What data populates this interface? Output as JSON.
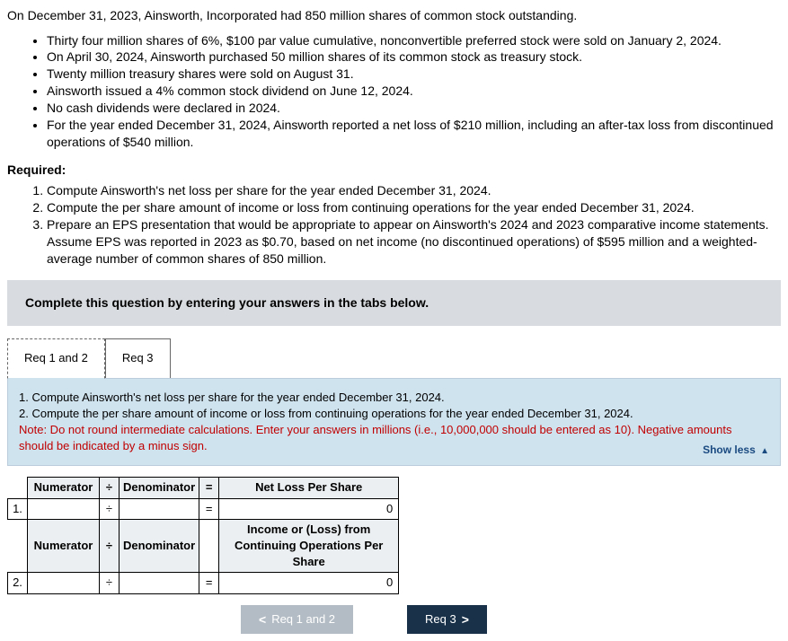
{
  "intro": "On December 31, 2023, Ainsworth, Incorporated had 850 million shares of common stock outstanding.",
  "bullets": [
    "Thirty four million shares of 6%, $100 par value cumulative, nonconvertible preferred stock were sold on January 2, 2024.",
    "On April 30, 2024, Ainsworth purchased 50 million shares of its common stock as treasury stock.",
    "Twenty million treasury shares were sold on August 31.",
    "Ainsworth issued a 4% common stock dividend on June 12, 2024.",
    "No cash dividends were declared in 2024.",
    "For the year ended December 31, 2024, Ainsworth reported a net loss of $210 million, including an after-tax loss from discontinued operations of $540 million."
  ],
  "required_label": "Required:",
  "requirements": [
    "Compute Ainsworth's net loss per share for the year ended December 31, 2024.",
    "Compute the per share amount of income or loss from continuing operations for the year ended December 31, 2024.",
    "Prepare an EPS presentation that would be appropriate to appear on Ainsworth's 2024 and 2023 comparative income statements. Assume EPS was reported in 2023 as $0.70, based on net income (no discontinued operations) of $595 million and a weighted-average number of common shares of 850 million."
  ],
  "instruction_box": "Complete this question by entering your answers in the tabs below.",
  "tabs": {
    "tab1": "Req 1 and 2",
    "tab2": "Req 3"
  },
  "tab_content": {
    "line1": "1. Compute Ainsworth's net loss per share for the year ended December 31, 2024.",
    "line2": "2. Compute the per share amount of income or loss from continuing operations for the year ended December 31, 2024.",
    "note": "Note: Do not round intermediate calculations. Enter your answers in millions (i.e., 10,000,000 should be entered as 10). Negative amounts should be indicated by a minus sign.",
    "showless": "Show less"
  },
  "table": {
    "h_numerator": "Numerator",
    "h_div": "÷",
    "h_denominator": "Denominator",
    "h_eq": "=",
    "h_netloss": "Net Loss Per Share",
    "h_cont": "Income or (Loss) from Continuing Operations Per Share",
    "idx1": "1.",
    "idx2": "2.",
    "op_div": "÷",
    "op_eq": "=",
    "res_zero": "0"
  },
  "nav": {
    "prev": "Req 1 and 2",
    "next": "Req 3",
    "lt": "<",
    "gt": ">"
  }
}
